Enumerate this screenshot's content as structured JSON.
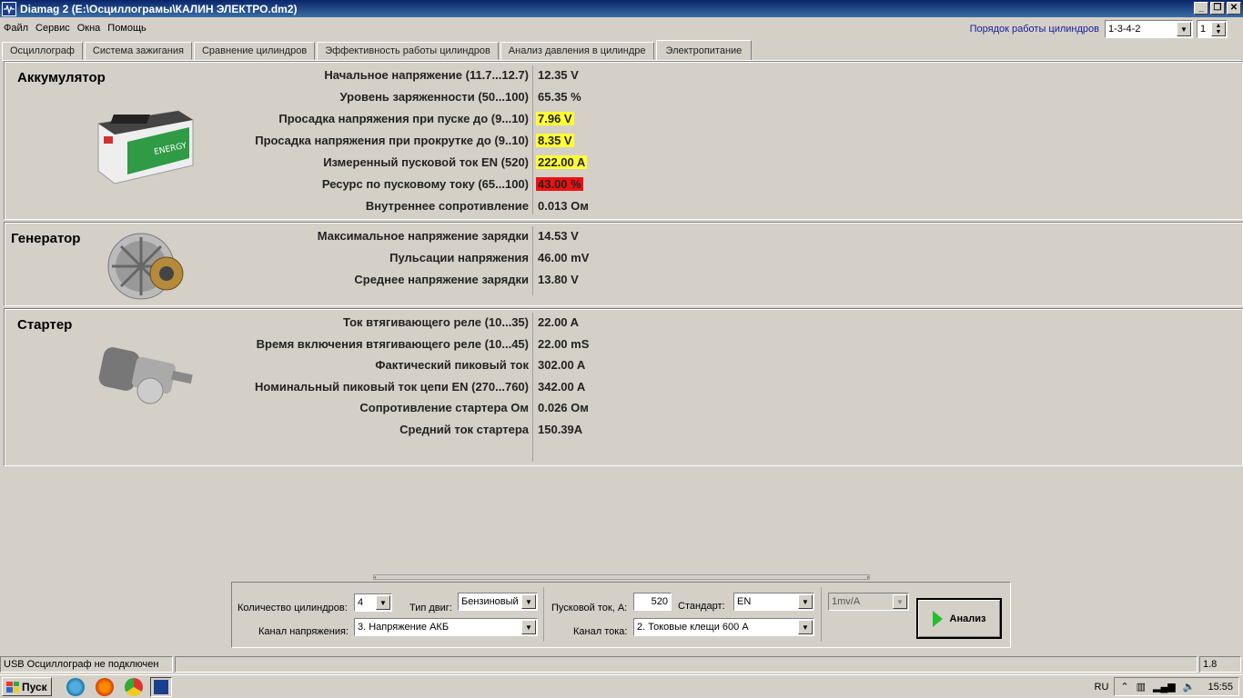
{
  "window": {
    "title": "Diamag 2 (E:\\Осциллограмы\\КАЛИН ЭЛЕКТРО.dm2)",
    "icon": "app-waveform-icon"
  },
  "menu": [
    "Файл",
    "Сервис",
    "Окна",
    "Помощь"
  ],
  "cylinder_order": {
    "label": "Порядок работы цилиндров",
    "value": "1-3-4-2",
    "spin_value": "1"
  },
  "tabs": [
    "Осциллограф",
    "Система зажигания",
    "Сравнение цилиндров",
    "Эффективность работы цилиндров",
    "Анализ давления в цилиндре",
    "Электропитание"
  ],
  "active_tab": "Электропитание",
  "battery": {
    "title": "Аккумулятор",
    "image": "car-battery-icon",
    "rows": [
      {
        "label": "Начальное напряжение (11.7...12.7)",
        "value": "12.35 V",
        "highlight": ""
      },
      {
        "label": "Уровень заряженности (50...100)",
        "value": "65.35 %",
        "highlight": ""
      },
      {
        "label": "Просадка напряжения при пуске до (9...10)",
        "value": "7.96 V",
        "highlight": "#ffff33"
      },
      {
        "label": "Просадка напряжения при прокрутке до  (9..10)",
        "value": "8.35 V",
        "highlight": "#ffff33"
      },
      {
        "label": "Измеренный пусковой ток  EN (520)",
        "value": "222.00 A",
        "highlight": "#ffff33"
      },
      {
        "label": "Ресурс по пусковому току (65...100)",
        "value": "43.00 %",
        "highlight": "#ee1111"
      },
      {
        "label": "Внутреннее сопротивление",
        "value": "0.013 Ом",
        "highlight": ""
      }
    ]
  },
  "generator": {
    "title": "Генератор",
    "image": "alternator-icon",
    "rows": [
      {
        "label": "Максимальное напряжение зарядки",
        "value": "14.53 V"
      },
      {
        "label": "Пульсации напряжения",
        "value": "46.00 mV"
      },
      {
        "label": "Среднее напряжение зарядки",
        "value": "13.80 V"
      }
    ]
  },
  "starter": {
    "title": "Стартер",
    "image": "starter-motor-icon",
    "rows": [
      {
        "label": "Ток втягивающего реле (10...35)",
        "value": "22.00 A"
      },
      {
        "label": "Время включения втягивающего реле (10...45)",
        "value": "22.00 mS"
      },
      {
        "label": "Фактический пиковый ток",
        "value": "302.00 A"
      },
      {
        "label": "Номинальный пиковый ток цепи EN (270...760)",
        "value": "342.00 A"
      },
      {
        "label": "Сопротивление стартера Ом",
        "value": "0.026 Ом"
      },
      {
        "label": "Средний ток стартера",
        "value": "150.39A"
      }
    ]
  },
  "controls": {
    "cylinders_label": "Количество цилиндров:",
    "cylinders_value": "4",
    "engine_type_label": "Тип двиг:",
    "engine_type_value": "Бензиновый",
    "voltage_channel_label": "Канал напряжения:",
    "voltage_channel_value": "3.  Напряжение АКБ",
    "start_current_label": "Пусковой ток, А:",
    "start_current_value": "520",
    "standard_label": "Стандарт:",
    "standard_value": "EN",
    "current_channel_label": "Канал тока:",
    "current_channel_value": "2.   Токовые клещи 600 А",
    "scale_value": "1mv/A",
    "analyze_label": "Анализ"
  },
  "status": {
    "text": "USB Осциллограф не подключен",
    "version": "1.8"
  },
  "taskbar": {
    "start_label": "Пуск",
    "lang": "RU",
    "time": "15:55"
  }
}
